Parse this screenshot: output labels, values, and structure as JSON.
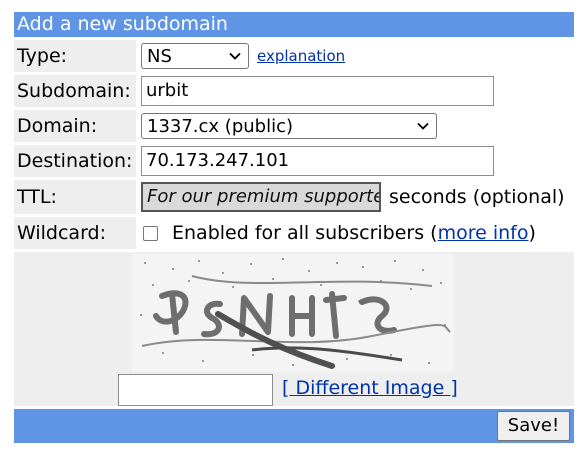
{
  "form": {
    "title": "Add a new subdomain",
    "type": {
      "label": "Type:",
      "selected": "NS",
      "explanation_link": "explanation"
    },
    "subdomain": {
      "label": "Subdomain:",
      "value": "urbit"
    },
    "domain": {
      "label": "Domain:",
      "selected": "1337.cx (public)"
    },
    "destination": {
      "label": "Destination:",
      "value": "70.173.247.101"
    },
    "ttl": {
      "label": "TTL:",
      "value": "For our premium supporte",
      "suffix": "seconds (optional)"
    },
    "wildcard": {
      "label": "Wildcard:",
      "checked": false,
      "text_before": "Enabled for all subscribers (",
      "more_info_link": "more info",
      "text_after": ")"
    },
    "captcha": {
      "input_value": "",
      "different_image_open": "[ ",
      "different_image_link": "Different Image ",
      "different_image_close": "]"
    },
    "save_label": "Save!"
  },
  "colors": {
    "header_bar": "#5f95e4",
    "label_bg": "#eeeeee",
    "link": "#0033aa"
  }
}
